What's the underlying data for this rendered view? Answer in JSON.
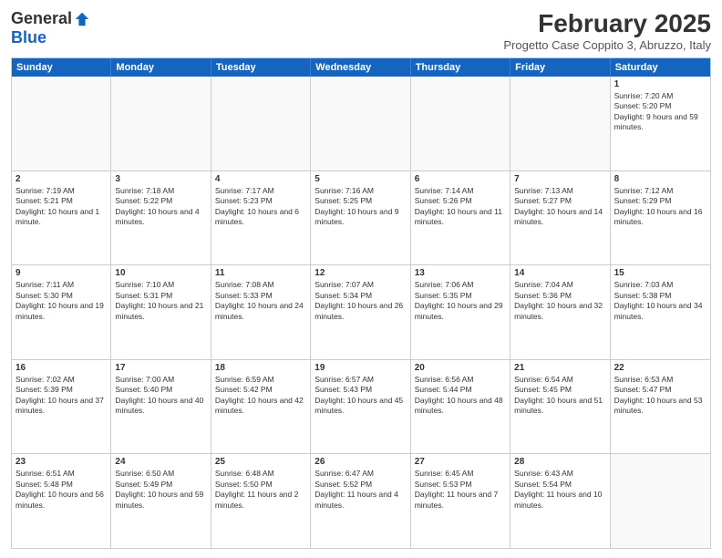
{
  "logo": {
    "general": "General",
    "blue": "Blue"
  },
  "title": "February 2025",
  "subtitle": "Progetto Case Coppito 3, Abruzzo, Italy",
  "header": {
    "days": [
      "Sunday",
      "Monday",
      "Tuesday",
      "Wednesday",
      "Thursday",
      "Friday",
      "Saturday"
    ]
  },
  "weeks": [
    {
      "cells": [
        {
          "empty": true
        },
        {
          "empty": true
        },
        {
          "empty": true
        },
        {
          "empty": true
        },
        {
          "empty": true
        },
        {
          "empty": true
        },
        {
          "day": "1",
          "text": "Sunrise: 7:20 AM\nSunset: 5:20 PM\nDaylight: 9 hours and 59 minutes."
        }
      ]
    },
    {
      "cells": [
        {
          "day": "2",
          "text": "Sunrise: 7:19 AM\nSunset: 5:21 PM\nDaylight: 10 hours and 1 minute."
        },
        {
          "day": "3",
          "text": "Sunrise: 7:18 AM\nSunset: 5:22 PM\nDaylight: 10 hours and 4 minutes."
        },
        {
          "day": "4",
          "text": "Sunrise: 7:17 AM\nSunset: 5:23 PM\nDaylight: 10 hours and 6 minutes."
        },
        {
          "day": "5",
          "text": "Sunrise: 7:16 AM\nSunset: 5:25 PM\nDaylight: 10 hours and 9 minutes."
        },
        {
          "day": "6",
          "text": "Sunrise: 7:14 AM\nSunset: 5:26 PM\nDaylight: 10 hours and 11 minutes."
        },
        {
          "day": "7",
          "text": "Sunrise: 7:13 AM\nSunset: 5:27 PM\nDaylight: 10 hours and 14 minutes."
        },
        {
          "day": "8",
          "text": "Sunrise: 7:12 AM\nSunset: 5:29 PM\nDaylight: 10 hours and 16 minutes."
        }
      ]
    },
    {
      "cells": [
        {
          "day": "9",
          "text": "Sunrise: 7:11 AM\nSunset: 5:30 PM\nDaylight: 10 hours and 19 minutes."
        },
        {
          "day": "10",
          "text": "Sunrise: 7:10 AM\nSunset: 5:31 PM\nDaylight: 10 hours and 21 minutes."
        },
        {
          "day": "11",
          "text": "Sunrise: 7:08 AM\nSunset: 5:33 PM\nDaylight: 10 hours and 24 minutes."
        },
        {
          "day": "12",
          "text": "Sunrise: 7:07 AM\nSunset: 5:34 PM\nDaylight: 10 hours and 26 minutes."
        },
        {
          "day": "13",
          "text": "Sunrise: 7:06 AM\nSunset: 5:35 PM\nDaylight: 10 hours and 29 minutes."
        },
        {
          "day": "14",
          "text": "Sunrise: 7:04 AM\nSunset: 5:36 PM\nDaylight: 10 hours and 32 minutes."
        },
        {
          "day": "15",
          "text": "Sunrise: 7:03 AM\nSunset: 5:38 PM\nDaylight: 10 hours and 34 minutes."
        }
      ]
    },
    {
      "cells": [
        {
          "day": "16",
          "text": "Sunrise: 7:02 AM\nSunset: 5:39 PM\nDaylight: 10 hours and 37 minutes."
        },
        {
          "day": "17",
          "text": "Sunrise: 7:00 AM\nSunset: 5:40 PM\nDaylight: 10 hours and 40 minutes."
        },
        {
          "day": "18",
          "text": "Sunrise: 6:59 AM\nSunset: 5:42 PM\nDaylight: 10 hours and 42 minutes."
        },
        {
          "day": "19",
          "text": "Sunrise: 6:57 AM\nSunset: 5:43 PM\nDaylight: 10 hours and 45 minutes."
        },
        {
          "day": "20",
          "text": "Sunrise: 6:56 AM\nSunset: 5:44 PM\nDaylight: 10 hours and 48 minutes."
        },
        {
          "day": "21",
          "text": "Sunrise: 6:54 AM\nSunset: 5:45 PM\nDaylight: 10 hours and 51 minutes."
        },
        {
          "day": "22",
          "text": "Sunrise: 6:53 AM\nSunset: 5:47 PM\nDaylight: 10 hours and 53 minutes."
        }
      ]
    },
    {
      "cells": [
        {
          "day": "23",
          "text": "Sunrise: 6:51 AM\nSunset: 5:48 PM\nDaylight: 10 hours and 56 minutes."
        },
        {
          "day": "24",
          "text": "Sunrise: 6:50 AM\nSunset: 5:49 PM\nDaylight: 10 hours and 59 minutes."
        },
        {
          "day": "25",
          "text": "Sunrise: 6:48 AM\nSunset: 5:50 PM\nDaylight: 11 hours and 2 minutes."
        },
        {
          "day": "26",
          "text": "Sunrise: 6:47 AM\nSunset: 5:52 PM\nDaylight: 11 hours and 4 minutes."
        },
        {
          "day": "27",
          "text": "Sunrise: 6:45 AM\nSunset: 5:53 PM\nDaylight: 11 hours and 7 minutes."
        },
        {
          "day": "28",
          "text": "Sunrise: 6:43 AM\nSunset: 5:54 PM\nDaylight: 11 hours and 10 minutes."
        },
        {
          "empty": true
        }
      ]
    }
  ]
}
